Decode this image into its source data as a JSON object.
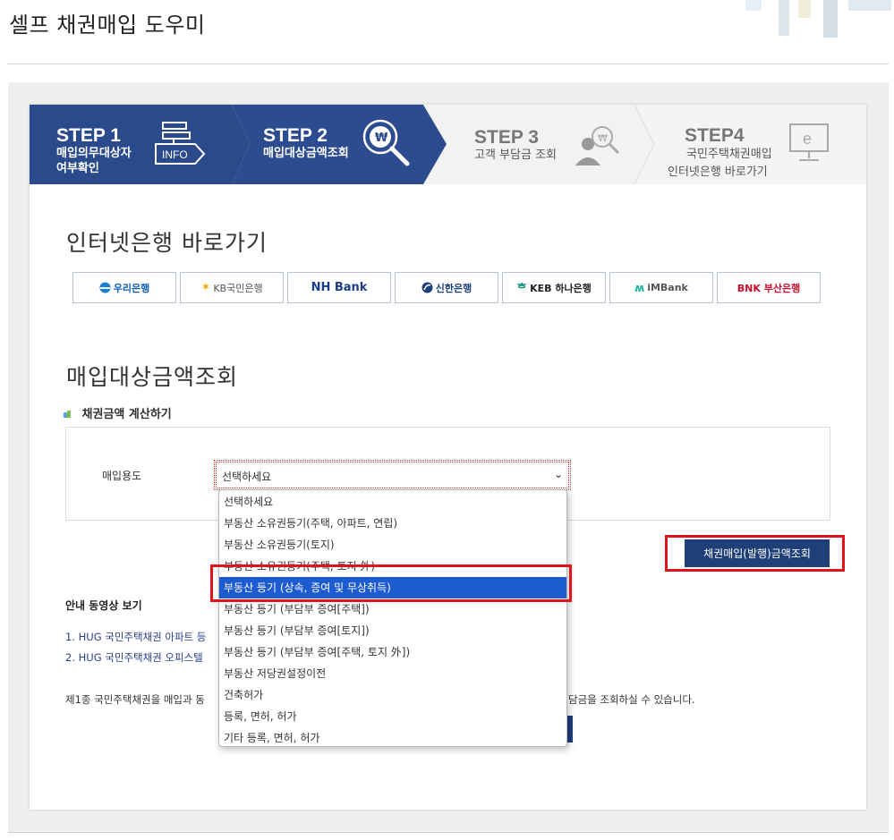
{
  "page": {
    "title": "셀프 채권매입 도우미"
  },
  "steps": [
    {
      "num": "STEP 1",
      "sub1": "매입의무대상자",
      "sub2": "여부확인",
      "icon": "info-signpost-icon",
      "icon_text": "INFO",
      "active": true
    },
    {
      "num": "STEP 2",
      "sub1": "매입대상금액조회",
      "icon": "won-magnifier-icon",
      "active": true
    },
    {
      "num": "STEP 3",
      "sub1": "고객 부담금 조회",
      "icon": "person-won-icon",
      "active": false
    },
    {
      "num": "STEP4",
      "sub1": "국민주택채권매입",
      "sub2": "인터넷은행 바로가기",
      "icon": "e-monitor-icon",
      "active": false
    }
  ],
  "bank_section": {
    "title": "인터넷은행 바로가기",
    "banks": [
      {
        "label": "우리은행",
        "icon": "woori-logo"
      },
      {
        "label": "KB국민은행",
        "icon": "kb-logo"
      },
      {
        "label": "NH Bank",
        "icon": "nh-logo"
      },
      {
        "label": "신한은행",
        "icon": "shinhan-logo"
      },
      {
        "label": "KEB 하나은행",
        "icon": "keb-hana-logo"
      },
      {
        "label": "iMBank",
        "icon": "imbank-logo"
      },
      {
        "label": "BNK 부산은행",
        "icon": "bnk-logo"
      }
    ]
  },
  "amount_section": {
    "title": "매입대상금액조회",
    "subtitle": "채권금액 계산하기",
    "field_label": "매입용도",
    "select_value": "선택하세요",
    "query_button": "채권매입(발행)금액조회"
  },
  "dropdown": {
    "options": [
      "선택하세요",
      "부동산 소유권등기(주택, 아파트, 연립)",
      "부동산 소유권등기(토지)",
      "부동산 소유권등기(주택, 토지 外)",
      "부동산 등기 (상속, 증여 및 무상취득)",
      "부동산 등기 (부담부 증여[주택])",
      "부동산 등기 (부담부 증여[토지])",
      "부동산 등기 (부담부 증여[주택, 토지 外])",
      "부동산 저당권설정이전",
      "건축허가",
      "등록, 면허, 허가",
      "기타 등록, 면허, 허가"
    ],
    "selected_index": 4
  },
  "videos": {
    "title": "안내 동영상 보기",
    "links": [
      "1. HUG 국민주택채권 아파트 등",
      "2. HUG 국민주택채권 오피스텔"
    ]
  },
  "notice": {
    "left": "제1종 국민주택채권을 매입과 동",
    "right": "담금을 조회하실 수 있습니다."
  },
  "colors": {
    "step_active": "#2b4a8c",
    "step_inactive": "#f2f2f2",
    "button": "#1f3f78",
    "highlight": "#e0131b",
    "option_selected": "#1c5bd0"
  }
}
